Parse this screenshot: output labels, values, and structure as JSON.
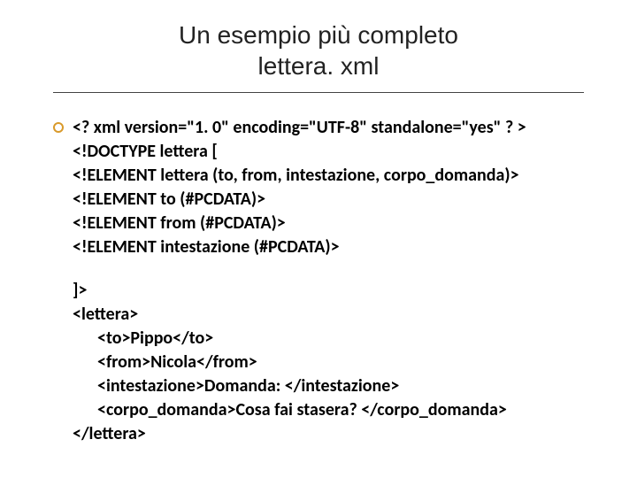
{
  "title": {
    "line1": "Un esempio più completo",
    "line2": "lettera. xml"
  },
  "dtd": {
    "l1": "<? xml version=\"1. 0\" encoding=\"UTF-8\" standalone=\"yes\" ? >",
    "l2": "<!DOCTYPE lettera [",
    "l3": "<!ELEMENT lettera (to, from, intestazione, corpo_domanda)>",
    "l4": "<!ELEMENT to (#PCDATA)>",
    "l5": "<!ELEMENT from (#PCDATA)>",
    "l6": "<!ELEMENT intestazione (#PCDATA)>"
  },
  "close": "]>",
  "xml": {
    "open": "<lettera>",
    "to": "<to>Pippo</to>",
    "from": "<from>Nicola</from>",
    "intest": "<intestazione>Domanda: </intestazione>",
    "corpo": "<corpo_domanda>Cosa fai stasera? </corpo_domanda>",
    "closeTag": "</lettera>"
  }
}
